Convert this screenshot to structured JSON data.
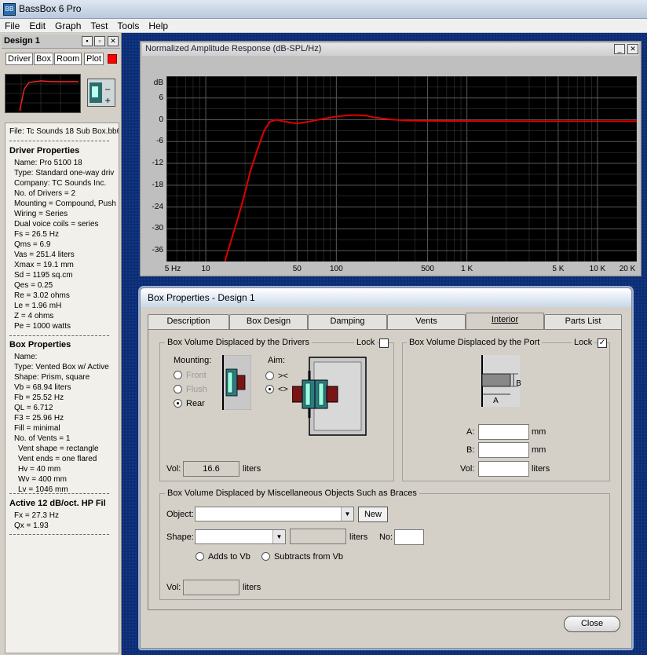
{
  "app": {
    "title": "BassBox 6 Pro",
    "icon": "app-icon"
  },
  "menu": [
    "File",
    "Edit",
    "Graph",
    "Test",
    "Tools",
    "Help"
  ],
  "design": {
    "title": "Design 1",
    "tabs": [
      "Driver",
      "Box",
      "Room",
      "Plot"
    ],
    "file": "File: Tc Sounds 18 Sub Box.bb6",
    "driver_header": "Driver Properties",
    "driver": [
      "Name: Pro 5100 18",
      "Type: Standard one-way driv",
      "Company: TC Sounds Inc.",
      "No. of Drivers = 2",
      "Mounting = Compound, Push",
      "Wiring = Series",
      "Dual voice coils = series",
      "Fs =  26.5 Hz",
      "Qms =  6.9",
      "Vas =  251.4 liters",
      "Xmax =  19.1 mm",
      "Sd =  1195 sq.cm",
      "Qes =  0.25",
      "Re =  3.02 ohms",
      "Le =  1.96 mH",
      "Z =  4 ohms",
      "Pe =  1000 watts"
    ],
    "box_header": "Box Properties",
    "box": [
      "Name:",
      "Type: Vented Box w/ Active",
      "Shape: Prism, square",
      "Vb =  68.94 liters",
      "Fb =  25.52 Hz",
      "QL =  6.712",
      "F3 =  25.96 Hz",
      "Fill = minimal",
      "No. of Vents = 1"
    ],
    "vent": [
      "Vent shape = rectangle",
      "Vent ends = one flared",
      "Hv =  40 mm",
      "Wv =  400 mm",
      "Lv =  1046 mm"
    ],
    "filter_header": "Active 12 dB/oct. HP Fil",
    "filter": [
      "Fx =  27.3 Hz",
      "Qx =  1.93"
    ]
  },
  "graph": {
    "title": "Normalized Amplitude Response (dB-SPL/Hz)"
  },
  "chart_data": {
    "type": "line",
    "title": "Normalized Amplitude Response (dB-SPL/Hz)",
    "xscale": "log",
    "xlim": [
      5,
      20000
    ],
    "ylim": [
      -39,
      12
    ],
    "yticks": [
      "dB",
      "6",
      "0",
      "-6",
      "-12",
      "-18",
      "-24",
      "-30",
      "-36"
    ],
    "xticks": [
      "5 Hz",
      "10",
      "50",
      "100",
      "500",
      "1 K",
      "5 K",
      "10 K",
      "20 K"
    ],
    "grid": true,
    "series": [
      {
        "color": "#e00000",
        "x": [
          14,
          16,
          18,
          20,
          22,
          25,
          28,
          31,
          35,
          40,
          50,
          60,
          80,
          100,
          120,
          140,
          170,
          200,
          260,
          350,
          500,
          1000,
          5000,
          20000
        ],
        "y": [
          -39,
          -32,
          -26,
          -20,
          -14,
          -8,
          -3,
          -0.5,
          0,
          -0.5,
          -1,
          -0.6,
          0.3,
          0.9,
          1.2,
          1.3,
          1.1,
          0.6,
          0.1,
          -0.2,
          -0.3,
          -0.35,
          -0.4,
          -0.4
        ]
      }
    ]
  },
  "boxprops": {
    "title": "Box Properties - Design 1",
    "tabs": [
      "Description",
      "Box Design",
      "Damping",
      "Vents",
      "Interior",
      "Parts List"
    ],
    "drivers_group": {
      "title": "Box Volume Displaced by the Drivers",
      "lock": "Lock",
      "lock_checked": false,
      "mounting_label": "Mounting:",
      "mounting": [
        "Front",
        "Flush",
        "Rear"
      ],
      "aim_label": "Aim:",
      "aim": [
        "><",
        "<>"
      ],
      "vol_label": "Vol:",
      "vol": "16.6",
      "vol_unit": "liters"
    },
    "port_group": {
      "title": "Box Volume Displaced by the Port",
      "lock": "Lock",
      "lock_checked": true,
      "a_label": "A:",
      "b_label": "B:",
      "vol_label": "Vol:",
      "mm": "mm",
      "liters": "liters",
      "dim_a": "A",
      "dim_b": "B"
    },
    "misc_group": {
      "title": "Box Volume Displaced by Miscellaneous Objects Such as Braces",
      "object_label": "Object:",
      "new": "New",
      "shape_label": "Shape:",
      "liters": "liters",
      "no_label": "No:",
      "adds": "Adds to Vb",
      "subtracts": "Subtracts from Vb",
      "vol_label": "Vol:"
    },
    "close": "Close"
  }
}
